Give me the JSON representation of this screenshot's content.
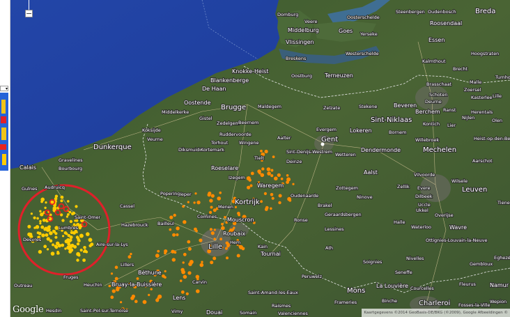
{
  "map": {
    "labels": [
      {
        "text": "Domburg",
        "size": "s"
      },
      {
        "text": "Veere",
        "size": "s"
      },
      {
        "text": "Middelburg",
        "size": "m"
      },
      {
        "text": "Goes",
        "size": "m"
      },
      {
        "text": "Yerseke",
        "size": "s"
      },
      {
        "text": "Vlissingen",
        "size": "m"
      },
      {
        "text": "Breskens",
        "size": "s"
      },
      {
        "text": "Oosterschelde",
        "size": "s"
      },
      {
        "text": "Westerschelde",
        "size": "s"
      },
      {
        "text": "Steenbergen",
        "size": "s"
      },
      {
        "text": "Oudenbosch",
        "size": "s"
      },
      {
        "text": "Breda",
        "size": "l"
      },
      {
        "text": "Roosendaal",
        "size": "m"
      },
      {
        "text": "Essen",
        "size": "m"
      },
      {
        "text": "Hoogstraten",
        "size": "s"
      },
      {
        "text": "Kalmthout",
        "size": "s"
      },
      {
        "text": "Brecht",
        "size": "s"
      },
      {
        "text": "Malle",
        "size": "s"
      },
      {
        "text": "Turnhout",
        "size": "s"
      },
      {
        "text": "Brasschaat",
        "size": "s"
      },
      {
        "text": "Zoersel",
        "size": "s"
      },
      {
        "text": "Schoten",
        "size": "s"
      },
      {
        "text": "Lille",
        "size": "s"
      },
      {
        "text": "Kasterlee",
        "size": "s"
      },
      {
        "text": "Deurne",
        "size": "s"
      },
      {
        "text": "Berchem",
        "size": "m"
      },
      {
        "text": "Ranst",
        "size": "s"
      },
      {
        "text": "Herentals",
        "size": "s"
      },
      {
        "text": "Nijlen",
        "size": "s"
      },
      {
        "text": "Olen",
        "size": "s"
      },
      {
        "text": "Kontich",
        "size": "s"
      },
      {
        "text": "Lier",
        "size": "s"
      },
      {
        "text": "Heist-op-den-Berg",
        "size": "s"
      },
      {
        "text": "Willebroek",
        "size": "s"
      },
      {
        "text": "Mechelen",
        "size": "l"
      },
      {
        "text": "Aarschot",
        "size": "s"
      },
      {
        "text": "Knokke-Heist",
        "size": "m"
      },
      {
        "text": "Blankenberge",
        "size": "m"
      },
      {
        "text": "De Haan",
        "size": "m"
      },
      {
        "text": "Oostburg",
        "size": "s"
      },
      {
        "text": "Terneuzen",
        "size": "m"
      },
      {
        "text": "Oostende",
        "size": "m"
      },
      {
        "text": "Middelkerke",
        "size": "s"
      },
      {
        "text": "Brugge",
        "size": "l"
      },
      {
        "text": "Maldegem",
        "size": "s"
      },
      {
        "text": "Zelzate",
        "size": "s"
      },
      {
        "text": "Stekene",
        "size": "s"
      },
      {
        "text": "Beveren",
        "size": "m"
      },
      {
        "text": "Sint-Niklaas",
        "size": "l"
      },
      {
        "text": "Gistel",
        "size": "s"
      },
      {
        "text": "Zedelgem",
        "size": "s"
      },
      {
        "text": "Beernem",
        "size": "s"
      },
      {
        "text": "Evergem",
        "size": "s"
      },
      {
        "text": "Gent",
        "size": "l"
      },
      {
        "text": "Lokeren",
        "size": "m"
      },
      {
        "text": "Bornem",
        "size": "s"
      },
      {
        "text": "Koksijde",
        "size": "s"
      },
      {
        "text": "Veurne",
        "size": "s"
      },
      {
        "text": "Ruddervoorde",
        "size": "s"
      },
      {
        "text": "Torhout",
        "size": "s"
      },
      {
        "text": "Wingene",
        "size": "s"
      },
      {
        "text": "Aalter",
        "size": "s"
      },
      {
        "text": "Sint-Denijs-Westrem",
        "size": "s"
      },
      {
        "text": "Wetteren",
        "size": "s"
      },
      {
        "text": "Dendermonde",
        "size": "m"
      },
      {
        "text": "Dunkerque",
        "size": "l"
      },
      {
        "text": "Diksmuide",
        "size": "s"
      },
      {
        "text": "Kortemark",
        "size": "s"
      },
      {
        "text": "Tielt",
        "size": "s"
      },
      {
        "text": "Deinze",
        "size": "s"
      },
      {
        "text": "Gravelines",
        "size": "s"
      },
      {
        "text": "Bourbourg",
        "size": "s"
      },
      {
        "text": "Roeselare",
        "size": "m"
      },
      {
        "text": "Izegem",
        "size": "s"
      },
      {
        "text": "Aalst",
        "size": "m"
      },
      {
        "text": "Vilvoorde",
        "size": "s"
      },
      {
        "text": "Wilsele",
        "size": "s"
      },
      {
        "text": "Calais",
        "size": "m"
      },
      {
        "text": "Waregem",
        "size": "m"
      },
      {
        "text": "Zottegem",
        "size": "s"
      },
      {
        "text": "Zellik",
        "size": "s"
      },
      {
        "text": "Evere",
        "size": "s"
      },
      {
        "text": "Leuven",
        "size": "l"
      },
      {
        "text": "Guînes",
        "size": "s"
      },
      {
        "text": "Audruicq",
        "size": "s"
      },
      {
        "text": "Poperinge",
        "size": "s"
      },
      {
        "text": "Ieper",
        "size": "s"
      },
      {
        "text": "Kortrijk",
        "size": "l"
      },
      {
        "text": "Oudenaarde",
        "size": "s"
      },
      {
        "text": "Ninove",
        "size": "s"
      },
      {
        "text": "Dilbeek",
        "size": "s"
      },
      {
        "text": "Tienen",
        "size": "s"
      },
      {
        "text": "Cassel",
        "size": "s"
      },
      {
        "text": "Menen",
        "size": "s"
      },
      {
        "text": "Brakel",
        "size": "s"
      },
      {
        "text": "Uccle",
        "size": "s"
      },
      {
        "text": "Ukkel",
        "size": "s"
      },
      {
        "text": "Geraardsbergen",
        "size": "s"
      },
      {
        "text": "Overijse",
        "size": "s"
      },
      {
        "text": "Saint-Omer",
        "size": "s"
      },
      {
        "text": "Comines",
        "size": "s"
      },
      {
        "text": "Mouscron",
        "size": "m"
      },
      {
        "text": "Ronse",
        "size": "s"
      },
      {
        "text": "Halle",
        "size": "s"
      },
      {
        "text": "Lumbres",
        "size": "s"
      },
      {
        "text": "Hazebrouck",
        "size": "s"
      },
      {
        "text": "Bailleul",
        "size": "s"
      },
      {
        "text": "Roubaix",
        "size": "m"
      },
      {
        "text": "Lessines",
        "size": "s"
      },
      {
        "text": "Waterloo",
        "size": "s"
      },
      {
        "text": "Wavre",
        "size": "m"
      },
      {
        "text": "Desvres",
        "size": "s"
      },
      {
        "text": "Aire-sur-la-Lys",
        "size": "s"
      },
      {
        "text": "Hem",
        "size": "s"
      },
      {
        "text": "Ottignies-Louvain-la-Neuve",
        "size": "s"
      },
      {
        "text": "Lille",
        "size": "l"
      },
      {
        "text": "Kain",
        "size": "s"
      },
      {
        "text": "Tournai",
        "size": "m"
      },
      {
        "text": "Ath",
        "size": "s"
      },
      {
        "text": "Nivelles",
        "size": "s"
      },
      {
        "text": "Lillers",
        "size": "s"
      },
      {
        "text": "Soignies",
        "size": "s"
      },
      {
        "text": "Gembloux",
        "size": "s"
      },
      {
        "text": "Eghezée",
        "size": "s"
      },
      {
        "text": "Béthune",
        "size": "m"
      },
      {
        "text": "Seneffe",
        "size": "s"
      },
      {
        "text": "Fleurus",
        "size": "s"
      },
      {
        "text": "Fruges",
        "size": "s"
      },
      {
        "text": "Bruay-la-Buissière",
        "size": "m"
      },
      {
        "text": "Peruwelz",
        "size": "s"
      },
      {
        "text": "Heuchin",
        "size": "s"
      },
      {
        "text": "Carvin",
        "size": "s"
      },
      {
        "text": "Namur",
        "size": "m"
      },
      {
        "text": "Mons",
        "size": "l"
      },
      {
        "text": "La Louvière",
        "size": "m"
      },
      {
        "text": "Courcelles",
        "size": "s"
      },
      {
        "text": "Lens",
        "size": "m"
      },
      {
        "text": "Saint-Amand-les-Eaux",
        "size": "s"
      },
      {
        "text": "Raismes",
        "size": "s"
      },
      {
        "text": "Frameries",
        "size": "s"
      },
      {
        "text": "Binche",
        "size": "s"
      },
      {
        "text": "Charleroi",
        "size": "l"
      },
      {
        "text": "Fosses-la-Ville",
        "size": "s"
      },
      {
        "text": "Wepion",
        "size": "s"
      },
      {
        "text": "Hesdin",
        "size": "s"
      },
      {
        "text": "Saint-Pol-sur-Ternoise",
        "size": "s"
      },
      {
        "text": "Vimy",
        "size": "s"
      },
      {
        "text": "Douai",
        "size": "m"
      },
      {
        "text": "Somain",
        "size": "s"
      },
      {
        "text": "Valenciennes",
        "size": "s"
      },
      {
        "text": "Outreau",
        "size": "s"
      }
    ],
    "cluster_highlight_color": "#e0202a",
    "marker_colors": {
      "yellow": "#ffcc00",
      "orange": "#ff8a00",
      "red": "#e8231e"
    }
  },
  "controls": {
    "zoom_out_label": "−",
    "panel_select_arrow": "▾"
  },
  "branding": {
    "logo": "Google"
  },
  "attribution": "Kaartgegevens ©2014 GeoBasis-DE/BKG (©2009), Google Afbeeldingen ©"
}
